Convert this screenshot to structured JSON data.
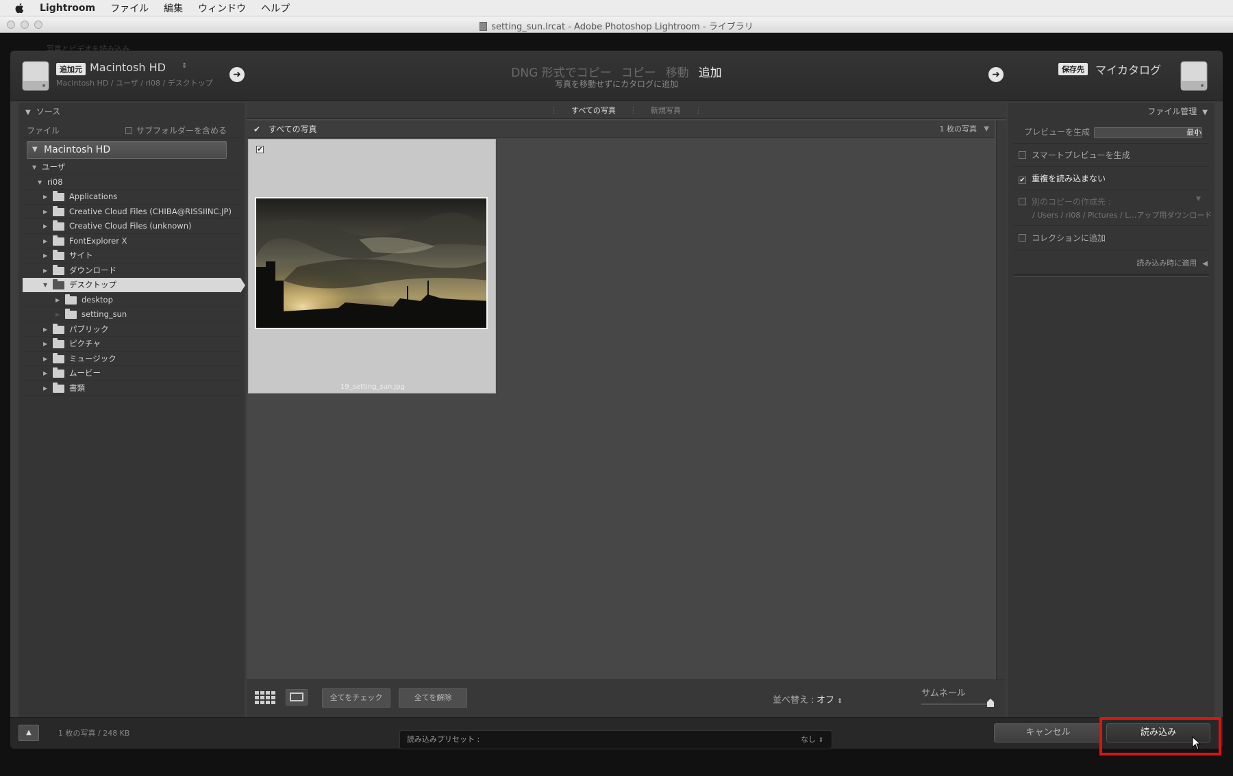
{
  "menubar": {
    "app_name": "Lightroom",
    "items": [
      "ファイル",
      "編集",
      "ウィンドウ",
      "ヘルプ"
    ]
  },
  "window": {
    "title": "setting_sun.lrcat - Adobe Photoshop Lightroom - ライブラリ"
  },
  "backdrop": {
    "ghost_text": "写真とビデオを読み込み"
  },
  "header": {
    "source_badge": "追加元",
    "source_name": "Macintosh HD",
    "source_path": "Macintosh HD / ユーザ / ri08 / デスクトップ",
    "modes": [
      "DNG 形式でコピー",
      "コピー",
      "移動",
      "追加"
    ],
    "active_mode": "追加",
    "mode_description": "写真を移動せずにカタログに追加",
    "dest_badge": "保存先",
    "dest_name": "マイカタログ"
  },
  "left_panel": {
    "title": "ソース",
    "file_label": "ファイル",
    "include_subfolders": "サブフォルダーを含める",
    "volume": "Macintosh HD",
    "tree": [
      {
        "label": "ユーザ",
        "level": 0,
        "expanded": true,
        "folder": false
      },
      {
        "label": "ri08",
        "level": 1,
        "expanded": true,
        "folder": false
      },
      {
        "label": "Applications",
        "level": 2,
        "expanded": false,
        "folder": true
      },
      {
        "label": "Creative Cloud Files (CHIBA@RISSIINC.JP)",
        "level": 2,
        "expanded": false,
        "folder": true
      },
      {
        "label": "Creative Cloud Files (unknown)",
        "level": 2,
        "expanded": false,
        "folder": true
      },
      {
        "label": "FontExplorer X",
        "level": 2,
        "expanded": false,
        "folder": true
      },
      {
        "label": "サイト",
        "level": 2,
        "expanded": false,
        "folder": true
      },
      {
        "label": "ダウンロード",
        "level": 2,
        "expanded": false,
        "folder": true
      },
      {
        "label": "デスクトップ",
        "level": 2,
        "expanded": true,
        "folder": true,
        "selected": true
      },
      {
        "label": "desktop",
        "level": 3,
        "expanded": false,
        "folder": true
      },
      {
        "label": "setting_sun",
        "level": 3,
        "expanded": false,
        "folder": true,
        "empty": true
      },
      {
        "label": "パブリック",
        "level": 2,
        "expanded": false,
        "folder": true
      },
      {
        "label": "ピクチャ",
        "level": 2,
        "expanded": false,
        "folder": true
      },
      {
        "label": "ミュージック",
        "level": 2,
        "expanded": false,
        "folder": true
      },
      {
        "label": "ムービー",
        "level": 2,
        "expanded": false,
        "folder": true
      },
      {
        "label": "書類",
        "level": 2,
        "expanded": false,
        "folder": true
      }
    ]
  },
  "center": {
    "tabs": [
      "すべての写真",
      "新規写真"
    ],
    "active_tab": "すべての写真",
    "grid_header_label": "すべての写真",
    "photo_count": "1 枚の写真",
    "photo": {
      "filename": "19_setting_sun.jpg",
      "checked": true
    },
    "check_all": "全てをチェック",
    "uncheck_all": "全てを解除",
    "sort_label": "並べ替え :",
    "sort_value": "オフ",
    "thumbnail_label": "サムネール"
  },
  "right_panel": {
    "title": "ファイル管理",
    "build_previews_label": "プレビューを生成",
    "build_previews_value": "最小",
    "smart_previews": "スマートプレビューを生成",
    "smart_previews_checked": false,
    "no_duplicates": "重複を読み込まない",
    "no_duplicates_checked": true,
    "second_copy": "別のコピーの作成先 :",
    "second_copy_path": "/ Users / ri08 / Pictures / L…アップ用ダウンロード",
    "add_to_collection": "コレクションに追加",
    "apply_during_import": "読み込み時に適用"
  },
  "bottom": {
    "summary": "1 枚の写真 / 248 KB",
    "preset_label": "読み込みプリセット :",
    "preset_value": "なし",
    "cancel": "キャンセル",
    "import": "読み込み"
  },
  "colors": {
    "highlight_box": "#e11111"
  }
}
